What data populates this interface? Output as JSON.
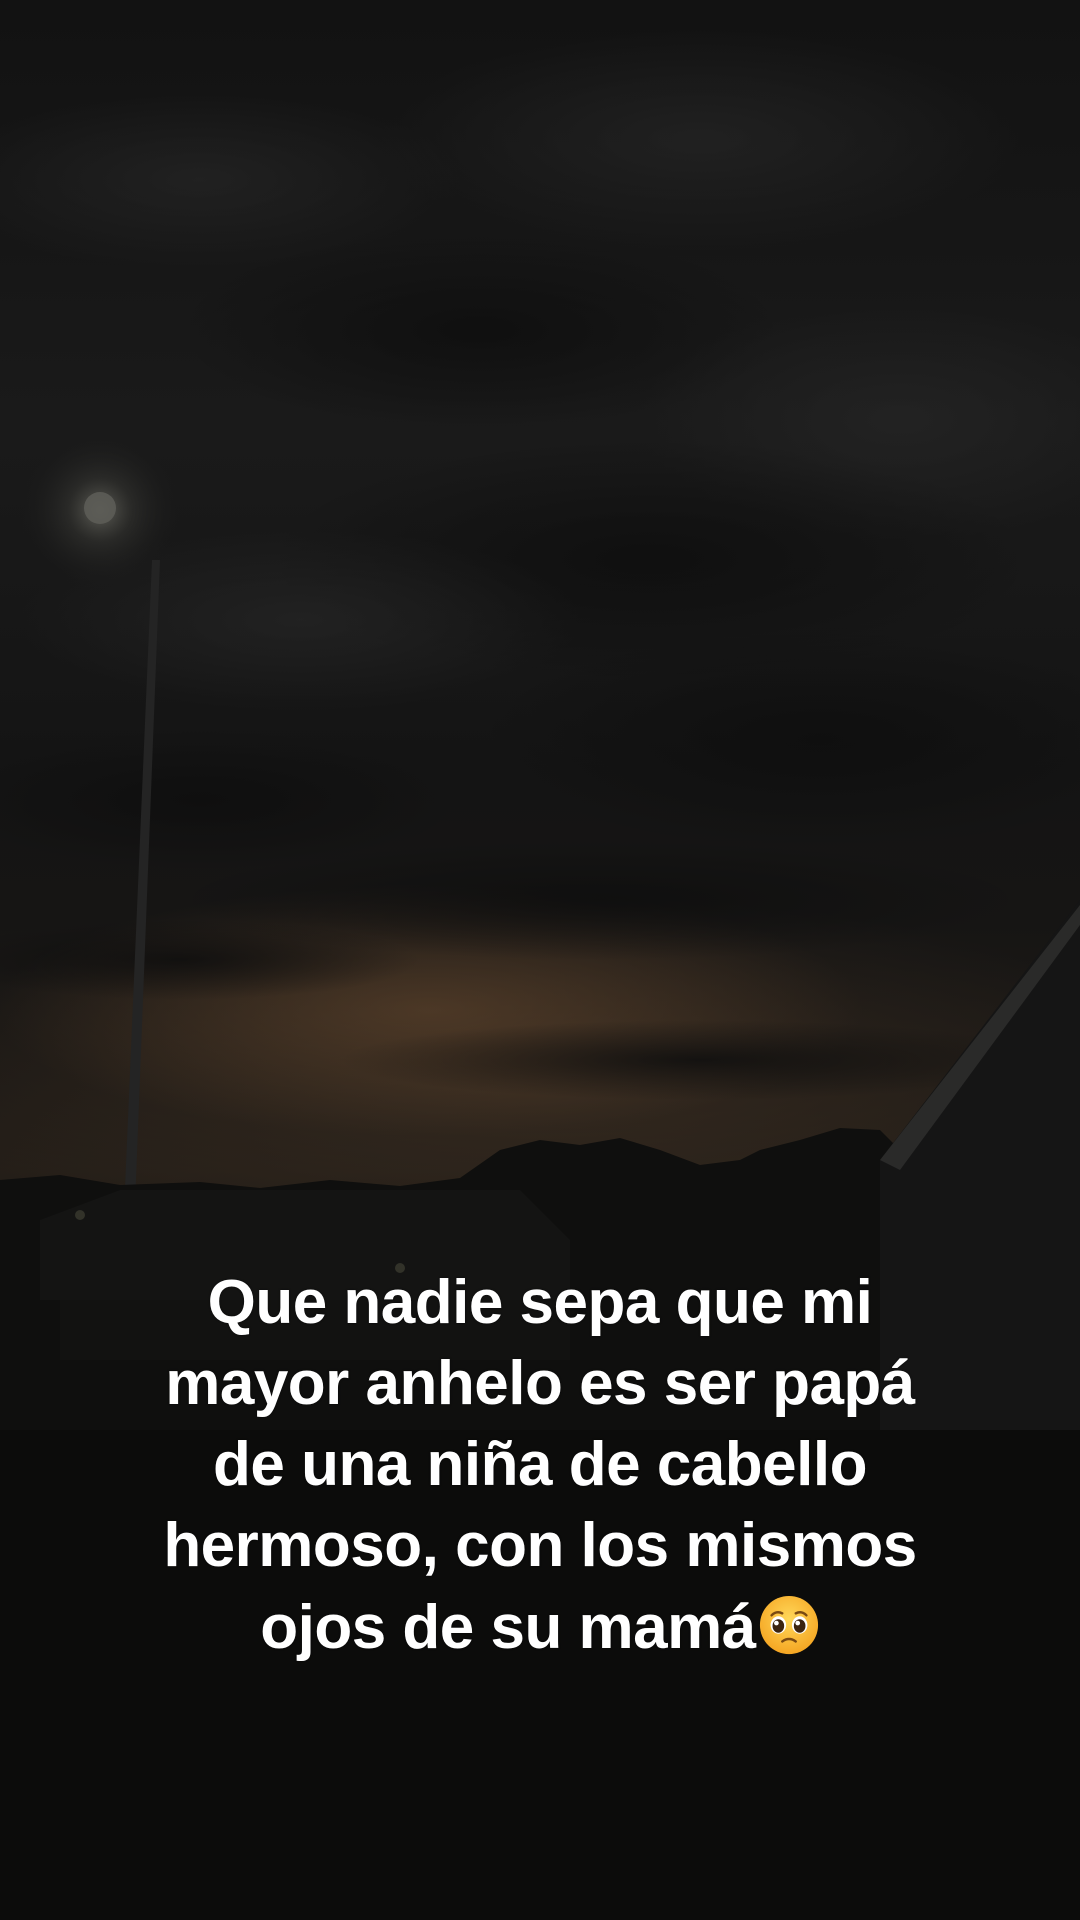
{
  "caption": {
    "lines": [
      "Que nadie sepa que mi",
      "mayor anhelo es ser papá",
      "de una niña de cabello",
      "hermoso, con los mismos",
      "ojos de su mamá"
    ],
    "emoji": "pleading-face-emoji"
  },
  "colors": {
    "caption_text": "#ffffff",
    "sky_dark": "#141414",
    "horizon_glow": "#3a2a1c",
    "ground": "#0b0b0a"
  }
}
